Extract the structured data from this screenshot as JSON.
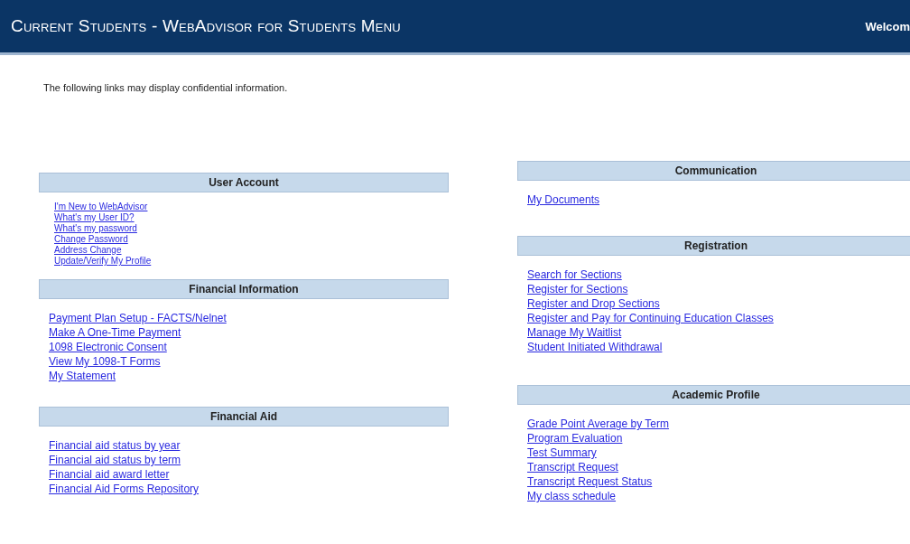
{
  "header": {
    "title": "Current Students - WebAdvisor for Students Menu",
    "welcome": "Welcom"
  },
  "notice": "The following links may display confidential information.",
  "columns": [
    {
      "sections": [
        {
          "title": "User Account",
          "kind": "compact",
          "links": [
            "I'm New to WebAdvisor",
            "What's my User ID?",
            "What's my password",
            "Change Password",
            "Address Change",
            "Update/Verify My Profile"
          ]
        },
        {
          "title": "Financial Information",
          "kind": "standard",
          "links": [
            "Payment Plan Setup - FACTS/Nelnet",
            "Make A One-Time Payment",
            "1098 Electronic Consent",
            "View My 1098-T Forms",
            "My Statement"
          ]
        },
        {
          "title": "Financial Aid",
          "kind": "standard",
          "links": [
            "Financial aid status by year",
            "Financial aid status by term",
            "Financial aid award letter",
            "Financial Aid Forms Repository"
          ]
        }
      ]
    },
    {
      "sections": [
        {
          "title": "Communication",
          "kind": "standard",
          "links": [
            "My Documents"
          ]
        },
        {
          "title": "Registration",
          "kind": "standard",
          "links": [
            "Search for Sections",
            "Register for Sections",
            "Register and Drop Sections",
            "Register and Pay for Continuing Education Classes",
            "Manage My Waitlist",
            "Student Initiated Withdrawal"
          ]
        },
        {
          "title": "Academic Profile",
          "kind": "standard",
          "links": [
            "Grade Point Average by Term",
            "Program Evaluation",
            "Test Summary",
            "Transcript Request",
            "Transcript Request Status",
            "My class schedule"
          ]
        }
      ]
    }
  ]
}
